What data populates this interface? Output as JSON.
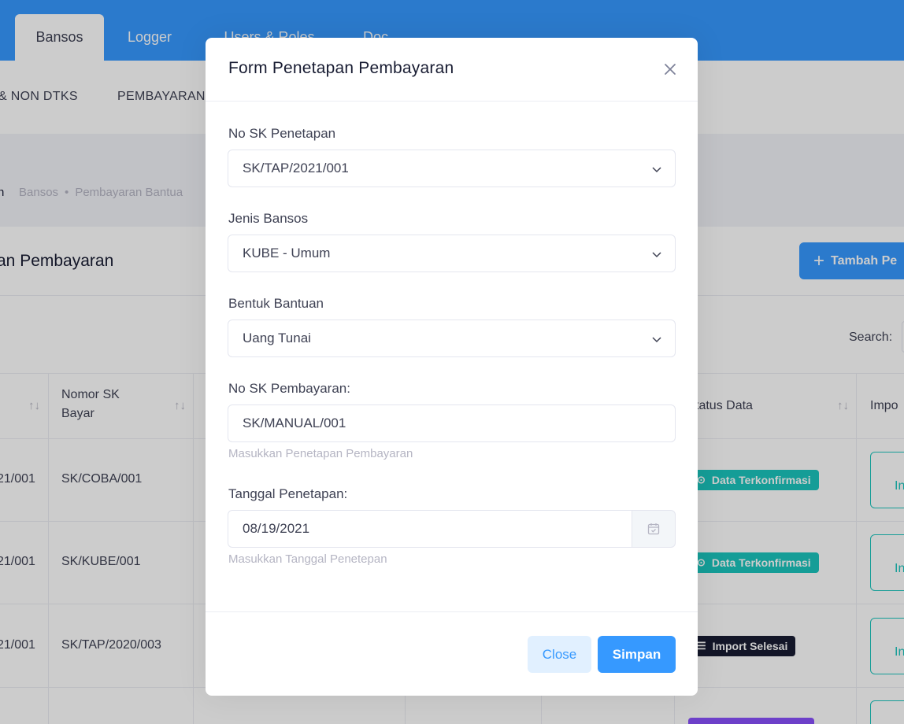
{
  "topnav": {
    "tabs": [
      {
        "label": "Bansos",
        "active": true
      },
      {
        "label": "Logger",
        "active": false
      },
      {
        "label": "Users & Roles",
        "active": false
      },
      {
        "label": "Doc",
        "active": false
      }
    ]
  },
  "subnav": {
    "items": [
      "& NON DTKS",
      "PEMBAYARAN"
    ]
  },
  "breadcrumb": {
    "current": "n",
    "items": [
      "Bansos",
      "Pembayaran Bantua"
    ]
  },
  "card": {
    "title": "an Pembayaran",
    "add_button": "Tambah Pe",
    "search_label": "Search:"
  },
  "table": {
    "headers": {
      "col2": "Nomor SK Bayar",
      "status": "tatus Data",
      "import": "Impo"
    },
    "rows": [
      {
        "col1": "21/001",
        "col2": "SK/COBA/001",
        "status": "Data Terkonfirmasi",
        "status_kind": "confirmed",
        "import": "In"
      },
      {
        "col1": "21/001",
        "col2": "SK/KUBE/001",
        "status": "Data Terkonfirmasi",
        "status_kind": "confirmed",
        "import": "In"
      },
      {
        "col1": "21/001",
        "col2": "SK/TAP/2020/003",
        "status": "Import Selesai",
        "status_kind": "import-done",
        "import": "In"
      }
    ]
  },
  "modal": {
    "title": "Form Penetapan Pembayaran",
    "fields": {
      "no_sk_penetapan": {
        "label": "No SK Penetapan",
        "value": "SK/TAP/2021/001"
      },
      "jenis_bansos": {
        "label": "Jenis Bansos",
        "value": "KUBE - Umum"
      },
      "bentuk_bantuan": {
        "label": "Bentuk Bantuan",
        "value": "Uang Tunai"
      },
      "no_sk_pembayaran": {
        "label": "No SK Pembayaran:",
        "value": "SK/MANUAL/001",
        "hint": "Masukkan Penetapan Pembayaran"
      },
      "tanggal_penetapan": {
        "label": "Tanggal Penetapan:",
        "value": "08/19/2021",
        "hint": "Masukkan Tanggal Penetepan"
      }
    },
    "buttons": {
      "close": "Close",
      "save": "Simpan"
    }
  },
  "colors": {
    "primary": "#3699ff",
    "primary_light": "#e1f0ff",
    "success": "#1bc5bd",
    "dark": "#181c32",
    "muted": "#b5b5c3"
  },
  "icons": [
    "close-icon",
    "chevron-down-icon",
    "calendar-icon",
    "plus-icon",
    "sort-icon",
    "check-circle-icon",
    "list-check-icon"
  ]
}
